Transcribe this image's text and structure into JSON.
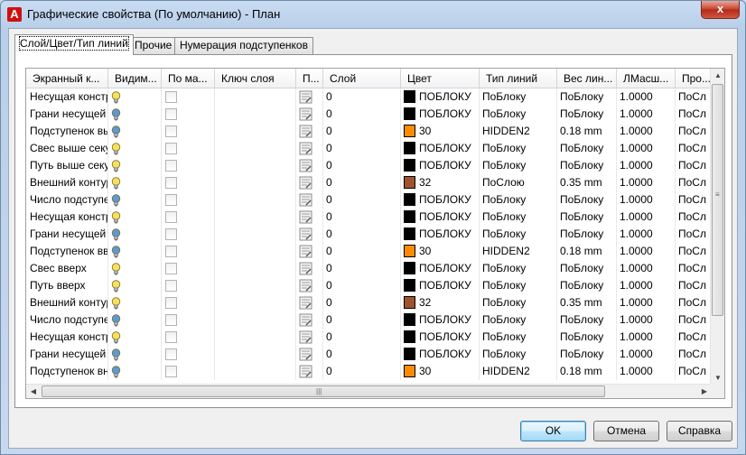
{
  "window": {
    "title": "Графические свойства (По умолчанию) - План",
    "app_icon_glyph": "A",
    "close_glyph": "x"
  },
  "tabs": [
    {
      "label": "Слой/Цвет/Тип линий",
      "active": true
    },
    {
      "label": "Прочие",
      "active": false
    },
    {
      "label": "Нумерация подступенков",
      "active": false
    }
  ],
  "columns": [
    "Экранный к...",
    "Видим...",
    "По ма...",
    "Ключ слоя",
    "П...",
    "Слой",
    "Цвет",
    "Тип линий",
    "Вес лин...",
    "ЛМасш...",
    "Про..."
  ],
  "colors": {
    "black": "#000000",
    "orange": "#ff8c00",
    "brown": "#a0522d",
    "bulb_on": "#f5e15c",
    "bulb_off": "#5b9ad8"
  },
  "rows": [
    {
      "name": "Несущая констру",
      "bulb": "on",
      "layer": "0",
      "swatch": "black",
      "color": "ПОБЛОКУ",
      "linetype": "ПоБлоку",
      "weight": "ПоБлоку",
      "scale": "1.0000",
      "prop": "ПоСл"
    },
    {
      "name": "Грани несущей к",
      "bulb": "off",
      "layer": "0",
      "swatch": "black",
      "color": "ПОБЛОКУ",
      "linetype": "ПоБлоку",
      "weight": "ПоБлоку",
      "scale": "1.0000",
      "prop": "ПоСл"
    },
    {
      "name": "Подступенок выш",
      "bulb": "off",
      "layer": "0",
      "swatch": "orange",
      "color": "30",
      "linetype": "HIDDEN2",
      "weight": "0.18 mm",
      "scale": "1.0000",
      "prop": "ПоСл"
    },
    {
      "name": "Свес выше секущ",
      "bulb": "on",
      "layer": "0",
      "swatch": "black",
      "color": "ПОБЛОКУ",
      "linetype": "ПоБлоку",
      "weight": "ПоБлоку",
      "scale": "1.0000",
      "prop": "ПоСл"
    },
    {
      "name": "Путь выше секущ",
      "bulb": "on",
      "layer": "0",
      "swatch": "black",
      "color": "ПОБЛОКУ",
      "linetype": "ПоБлоку",
      "weight": "ПоБлоку",
      "scale": "1.0000",
      "prop": "ПоСл"
    },
    {
      "name": "Внешний контур",
      "bulb": "on",
      "layer": "0",
      "swatch": "brown",
      "color": "32",
      "linetype": "ПоСлою",
      "weight": "0.35 mm",
      "scale": "1.0000",
      "prop": "ПоСл"
    },
    {
      "name": "Число подступенк",
      "bulb": "off",
      "layer": "0",
      "swatch": "black",
      "color": "ПОБЛОКУ",
      "linetype": "ПоБлоку",
      "weight": "ПоБлоку",
      "scale": "1.0000",
      "prop": "ПоСл"
    },
    {
      "name": "Несущая констру",
      "bulb": "on",
      "layer": "0",
      "swatch": "black",
      "color": "ПОБЛОКУ",
      "linetype": "ПоБлоку",
      "weight": "ПоБлоку",
      "scale": "1.0000",
      "prop": "ПоСл"
    },
    {
      "name": "Грани несущей к",
      "bulb": "off",
      "layer": "0",
      "swatch": "black",
      "color": "ПОБЛОКУ",
      "linetype": "ПоБлоку",
      "weight": "ПоБлоку",
      "scale": "1.0000",
      "prop": "ПоСл"
    },
    {
      "name": "Подступенок вве",
      "bulb": "off",
      "layer": "0",
      "swatch": "orange",
      "color": "30",
      "linetype": "HIDDEN2",
      "weight": "0.18 mm",
      "scale": "1.0000",
      "prop": "ПоСл"
    },
    {
      "name": "Свес вверх",
      "bulb": "on",
      "layer": "0",
      "swatch": "black",
      "color": "ПОБЛОКУ",
      "linetype": "ПоБлоку",
      "weight": "ПоБлоку",
      "scale": "1.0000",
      "prop": "ПоСл"
    },
    {
      "name": "Путь вверх",
      "bulb": "on",
      "layer": "0",
      "swatch": "black",
      "color": "ПОБЛОКУ",
      "linetype": "ПоБлоку",
      "weight": "ПоБлоку",
      "scale": "1.0000",
      "prop": "ПоСл"
    },
    {
      "name": "Внешний контур",
      "bulb": "on",
      "layer": "0",
      "swatch": "brown",
      "color": "32",
      "linetype": "ПоБлоку",
      "weight": "0.35 mm",
      "scale": "1.0000",
      "prop": "ПоСл"
    },
    {
      "name": "Число подступен",
      "bulb": "off",
      "layer": "0",
      "swatch": "black",
      "color": "ПОБЛОКУ",
      "linetype": "ПоБлоку",
      "weight": "ПоБлоку",
      "scale": "1.0000",
      "prop": "ПоСл"
    },
    {
      "name": "Несущая констру",
      "bulb": "on",
      "layer": "0",
      "swatch": "black",
      "color": "ПОБЛОКУ",
      "linetype": "ПоБлоку",
      "weight": "ПоБлоку",
      "scale": "1.0000",
      "prop": "ПоСл"
    },
    {
      "name": "Грани несущей к",
      "bulb": "off",
      "layer": "0",
      "swatch": "black",
      "color": "ПОБЛОКУ",
      "linetype": "ПоБлоку",
      "weight": "ПоБлоку",
      "scale": "1.0000",
      "prop": "ПоСл"
    },
    {
      "name": "Подступенок вни",
      "bulb": "off",
      "layer": "0",
      "swatch": "orange",
      "color": "30",
      "linetype": "HIDDEN2",
      "weight": "0.18 mm",
      "scale": "1.0000",
      "prop": "ПоСл"
    }
  ],
  "scrollbars": {
    "up_glyph": "▲",
    "down_glyph": "▼",
    "left_glyph": "◀",
    "right_glyph": "▶",
    "v_grip": "≡",
    "h_grip": "|||"
  },
  "buttons": {
    "ok": "OK",
    "cancel": "Отмена",
    "help": "Справка"
  }
}
